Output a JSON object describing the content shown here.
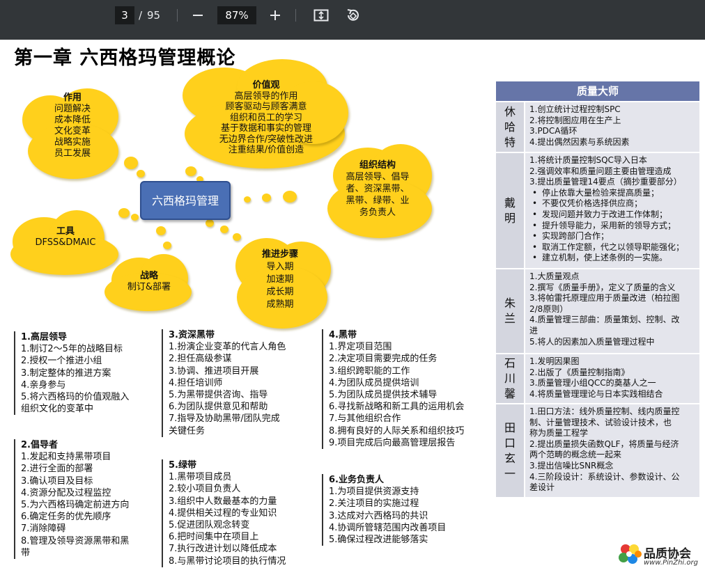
{
  "toolbar": {
    "page_current": "3",
    "page_sep": "/",
    "page_total": "95",
    "zoom": "87%"
  },
  "title": "第一章  六西格玛管理概论",
  "center": "六西格玛管理",
  "clouds": {
    "zuoyong": {
      "title": "作用",
      "lines": [
        "问题解决",
        "成本降低",
        "文化变革",
        "战略实施",
        "员工发展"
      ]
    },
    "jiazhi": {
      "title": "价值观",
      "lines": [
        "高层领导的作用",
        "顾客驱动与顾客满意",
        "组织和员工的学习",
        "基于数据和事实的管理",
        "无边界合作/突破性改进",
        "注重结果/价值创造"
      ]
    },
    "zuzhi": {
      "title": "组织结构",
      "lines": [
        "高层领导、倡导",
        "者、资深黑带、",
        "黑带、绿带、业",
        "务负责人"
      ]
    },
    "gongju": {
      "title": "工具",
      "lines": [
        "DFSS&DMAIC"
      ]
    },
    "zhanlue": {
      "title": "战略",
      "lines": [
        "制订&部署"
      ]
    },
    "tuijin": {
      "title": "推进步骤",
      "lines": [
        "导入期",
        "加速期",
        "成长期",
        "成熟期"
      ]
    }
  },
  "roles": [
    {
      "title": "1.高层领导",
      "lines": [
        "1.制订2～5年的战略目标",
        "2.授权一个推进小组",
        "3.制定整体的推进方案",
        "4.亲身参与",
        "5.将六西格玛的价值观融入",
        "组织文化的变革中"
      ]
    },
    {
      "title": "2.倡导者",
      "lines": [
        "1.发起和支持黑带项目",
        "2.进行全面的部署",
        "3.确认项目及目标",
        "4.资源分配及过程监控",
        "5.为六西格玛确定前进方向",
        "6.确定任务的优先顺序",
        "7.消除障碍",
        "8.管理及领导资源黑带和黑",
        "带"
      ]
    },
    {
      "title": "3.资深黑带",
      "lines": [
        "1.扮演企业变革的代言人角色",
        "2.担任高级参谋",
        "3.协调、推进项目开展",
        "4.担任培训师",
        "5.为黑带提供咨询、指导",
        "6.为团队提供意见和帮助",
        "7.指导及协助黑带/团队完成",
        "关键任务"
      ]
    },
    {
      "title": "5.绿带",
      "lines": [
        "1.黑带项目成员",
        "2.较小项目负责人",
        "3.组织中人数最基本的力量",
        "4.提供相关过程的专业知识",
        "5.促进团队观念转变",
        "6.把时间集中在项目上",
        "7.执行改进计划以降低成本",
        "8.与黑带讨论项目的执行情况"
      ]
    },
    {
      "title": "4.黑带",
      "lines": [
        "1.界定项目范围",
        "2.决定项目需要完成的任务",
        "3.组织跨职能的工作",
        "4.为团队成员提供培训",
        "5.为团队成员提供技术辅导",
        "6.寻找新战略和新工具的运用机会",
        "7.与其他组织合作",
        "8.拥有良好的人际关系和组织技巧",
        "9.项目完成后向最高管理层报告"
      ]
    },
    {
      "title": "6.业务负责人",
      "lines": [
        "1.为项目提供资源支持",
        "2.关注项目的实施过程",
        "3.达成对六西格玛的共识",
        "4.协调所管辖范围内改善项目",
        "5.确保过程改进能够落实"
      ]
    }
  ],
  "masters": {
    "header": "质量大师",
    "rows": [
      {
        "name": "休哈特",
        "lines": [
          "1.创立统计过程控制SPC",
          "2.将控制图应用在生产上",
          "3.PDCA循环",
          "4.提出偶然因素与系统因素"
        ],
        "subs": []
      },
      {
        "name": "戴明",
        "lines": [
          "1.将统计质量控制SQC导入日本",
          "2.强调效率和质量问题主要由管理造成",
          "3.提出质量管理14要点（摘抄重要部分）"
        ],
        "subs": [
          "停止依靠大量检验来提高质量；",
          "不要仅凭价格选择供应商；",
          "发现问题并致力于改进工作体制；",
          "提升领导能力，采用新的领导方式；",
          "实现跨部门合作；",
          "取消工作定额，代之以领导职能强化；",
          "建立机制，使上述条例的一实施。"
        ]
      },
      {
        "name": "朱兰",
        "lines": [
          "1.大质量观点",
          "2.撰写《质量手册》，定义了质量的含义",
          "3.将帕雷托原理应用于质量改进（柏拉图",
          "2/8原则）",
          "4.质量管理三部曲：质量策划、控制、改",
          "进",
          "5.将人的因素加入质量管理过程中"
        ],
        "subs": []
      },
      {
        "name": "石川馨",
        "lines": [
          "1.发明因果图",
          "2.出版了《质量控制指南》",
          "3.质量管理小组QCC的奠基人之一",
          "4.将质量管理理论与日本实践相结合"
        ],
        "subs": []
      },
      {
        "name": "田口玄一",
        "lines": [
          "1.田口方法：线外质量控制、线内质量控",
          "制、计量管理技术、试验设计技术，也",
          "称为质量工程学",
          "2.提出质量损失函数QLF，将质量与经济",
          "两个范畴的概念统一起来",
          "3.提出信噪比SNR概念",
          "4.三阶段设计：系统设计、参数设计、公",
          "差设计"
        ],
        "subs": []
      }
    ]
  },
  "logo": {
    "name": "品质协会",
    "url": "www.PinZhi.org"
  },
  "colors": {
    "cloud": "#ffd01c",
    "center": "#4a6fb5",
    "masters_header": "#6675a8",
    "toolbar": "#323639"
  }
}
